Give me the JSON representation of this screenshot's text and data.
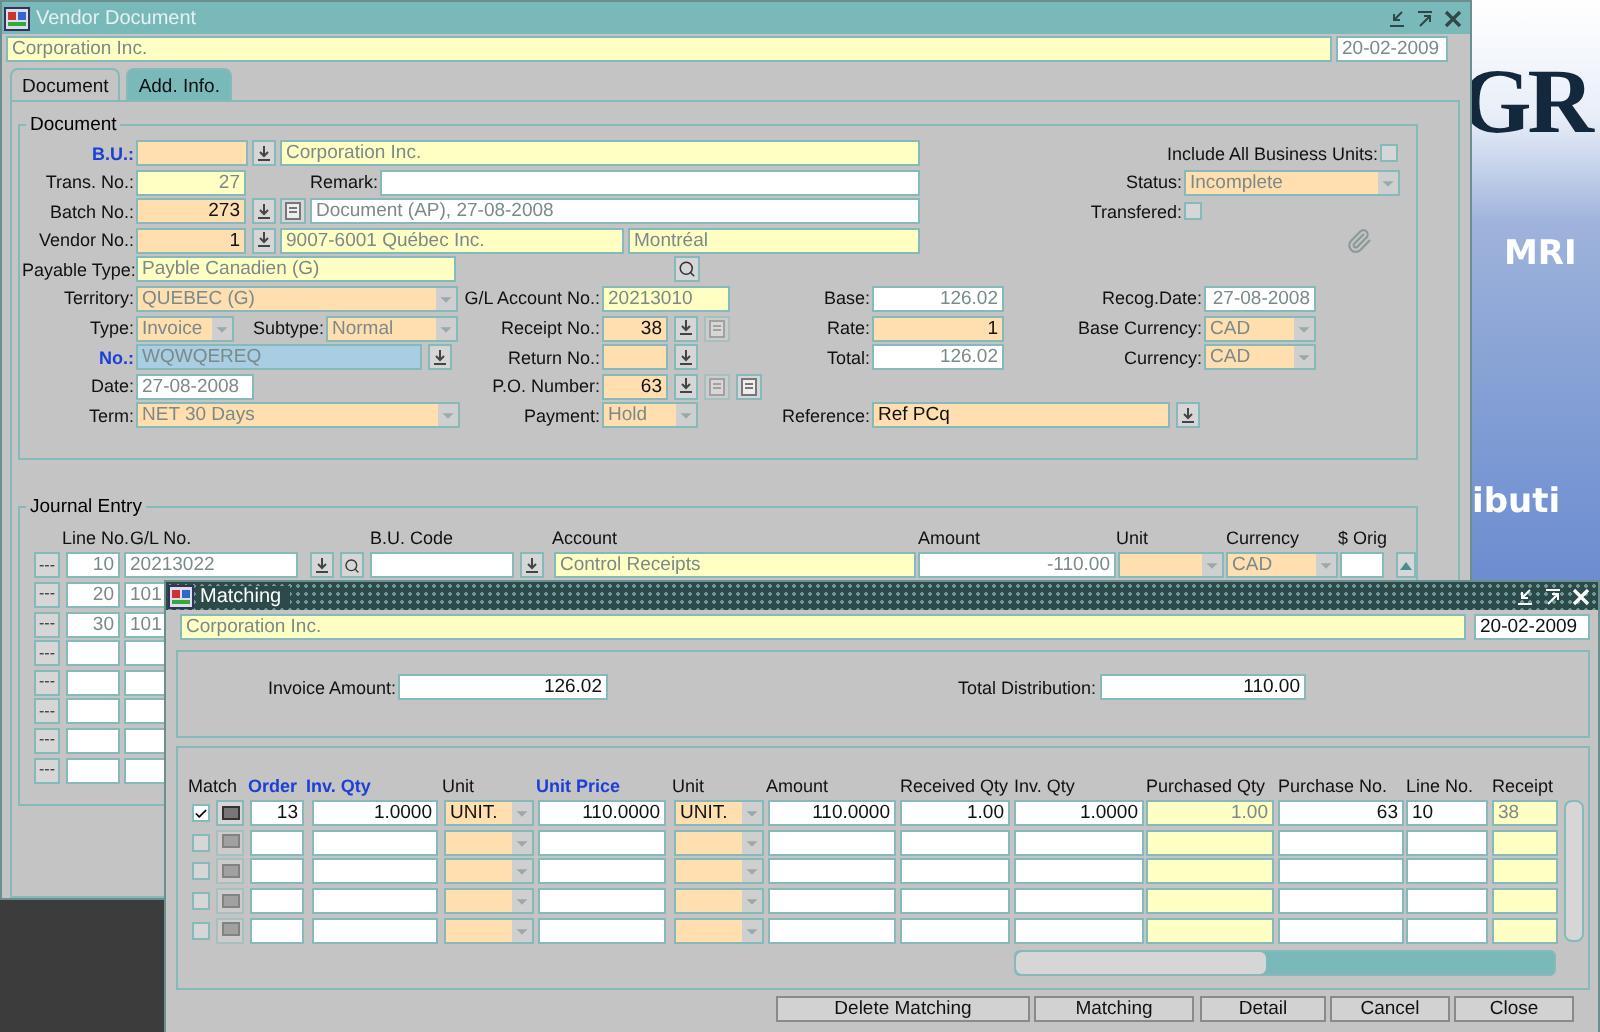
{
  "banner": {
    "texts": [
      "GR",
      "MRI",
      "ibuti"
    ]
  },
  "vendor_window": {
    "title": "Vendor Document",
    "company": "Corporation Inc.",
    "date": "20-02-2009",
    "tabs": [
      {
        "label": "Document",
        "selected": true
      },
      {
        "label": "Add. Info.",
        "selected": false
      }
    ],
    "document": {
      "legend": "Document",
      "bu": {
        "label": "B.U.:",
        "name": "Corporation Inc."
      },
      "include_all_bu": {
        "label": "Include All Business Units:",
        "checked": false
      },
      "trans_no": {
        "label": "Trans. No.:",
        "value": "27"
      },
      "remark": {
        "label": "Remark:"
      },
      "status": {
        "label": "Status:",
        "value": "Incomplete"
      },
      "batch_no": {
        "label": "Batch No.:",
        "value": "273",
        "description": "Document (AP), 27-08-2008"
      },
      "transfered": {
        "label": "Transfered:",
        "checked": false
      },
      "vendor_no": {
        "label": "Vendor No.:",
        "value": "1",
        "name": "9007-6001 Québec Inc.",
        "city": "Montréal"
      },
      "payable_type": {
        "label": "Payable Type:",
        "value": "Payble Canadien (G)"
      },
      "territory": {
        "label": "Territory:",
        "value": "QUEBEC (G)"
      },
      "gl_account": {
        "label": "G/L Account No.:",
        "value": "20213010"
      },
      "base": {
        "label": "Base:",
        "value": "126.02"
      },
      "recog_date": {
        "label": "Recog.Date:",
        "value": "27-08-2008"
      },
      "type": {
        "label": "Type:",
        "value": "Invoice"
      },
      "subtype": {
        "label": "Subtype:",
        "value": "Normal"
      },
      "receipt_no": {
        "label": "Receipt No.:",
        "value": "38"
      },
      "rate": {
        "label": "Rate:",
        "value": "1"
      },
      "base_currency": {
        "label": "Base Currency:",
        "value": "CAD"
      },
      "no": {
        "label": "No.:",
        "value": "WQWQEREQ"
      },
      "return_no": {
        "label": "Return No.:"
      },
      "total": {
        "label": "Total:",
        "value": "126.02"
      },
      "currency": {
        "label": "Currency:",
        "value": "CAD"
      },
      "date": {
        "label": "Date:",
        "value": "27-08-2008"
      },
      "po_number": {
        "label": "P.O. Number:",
        "value": "63"
      },
      "term": {
        "label": "Term:",
        "value": "NET 30 Days"
      },
      "payment": {
        "label": "Payment:",
        "value": "Hold"
      },
      "reference": {
        "label": "Reference:",
        "value": "Ref PCq"
      }
    },
    "journal": {
      "legend": "Journal Entry",
      "columns": [
        "Line No.",
        "G/L No.",
        "B.U. Code",
        "Account",
        "Amount",
        "Unit",
        "Currency",
        "$ Orig"
      ],
      "rows": [
        {
          "button": "---",
          "line": "10",
          "gl": "20213022",
          "account": "Control Receipts",
          "amount": "-110.00",
          "currency": "CAD"
        },
        {
          "button": "---",
          "line": "20",
          "gl": "101"
        },
        {
          "button": "---",
          "line": "30",
          "gl": "101"
        },
        {
          "button": "---"
        },
        {
          "button": "---"
        },
        {
          "button": "---"
        },
        {
          "button": "---"
        },
        {
          "button": "---"
        }
      ]
    }
  },
  "matching_window": {
    "title": "Matching",
    "company": "Corporation Inc.",
    "date": "20-02-2009",
    "invoice_amount": {
      "label": "Invoice Amount:",
      "value": "126.02"
    },
    "total_distribution": {
      "label": "Total Distribution:",
      "value": "110.00"
    },
    "columns": [
      {
        "label": "Match",
        "key": false
      },
      {
        "label": "Order",
        "key": true
      },
      {
        "label": "Inv. Qty",
        "key": true
      },
      {
        "label": "Unit",
        "key": false
      },
      {
        "label": "Unit Price",
        "key": true
      },
      {
        "label": "Unit",
        "key": false
      },
      {
        "label": "Amount",
        "key": false
      },
      {
        "label": "Received Qty",
        "key": false
      },
      {
        "label": "Inv. Qty",
        "key": false
      },
      {
        "label": "Purchased Qty",
        "key": false
      },
      {
        "label": "Purchase No.",
        "key": false
      },
      {
        "label": "Line No.",
        "key": false
      },
      {
        "label": "Receipt",
        "key": false
      }
    ],
    "rows": [
      {
        "matched": true,
        "disabled": false,
        "cells": [
          "13",
          "1.0000",
          "UNIT.",
          "110.0000",
          "UNIT.",
          "110.0000",
          "1.00",
          "1.0000",
          "1.00",
          "63",
          "10",
          "38"
        ]
      },
      {
        "matched": false,
        "disabled": true
      },
      {
        "matched": false,
        "disabled": true
      },
      {
        "matched": false,
        "disabled": true
      },
      {
        "matched": false,
        "disabled": true
      }
    ],
    "buttons": [
      "Delete Matching",
      "Matching",
      "Detail",
      "Cancel",
      "Close"
    ]
  }
}
